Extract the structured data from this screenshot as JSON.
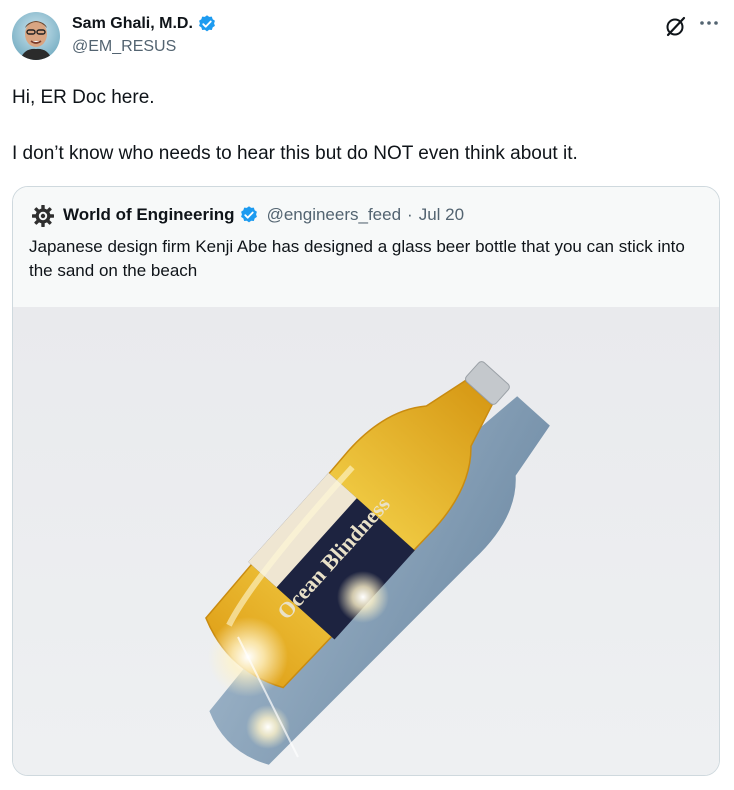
{
  "tweet": {
    "author": {
      "name": "Sam Ghali, M.D.",
      "handle": "@EM_RESUS",
      "verified": true
    },
    "icons": {
      "grok": "grok-icon",
      "more": "more-icon"
    },
    "text": {
      "line1": "Hi, ER Doc here.",
      "line2": "I don’t know who needs to hear this but do NOT even think about it."
    }
  },
  "quote": {
    "author": {
      "name": "World of Engineering",
      "handle": "@engineers_feed",
      "separator": "·",
      "date": "Jul 20",
      "verified": true
    },
    "text": "Japanese design firm Kenji Abe has designed a glass beer bottle that you can stick into the sand on the beach",
    "media": {
      "label_text": "Ocean Blindness"
    }
  },
  "colors": {
    "verified_blue": "#1d9bf0",
    "secondary_text": "#536471",
    "border": "#cfd9de"
  }
}
